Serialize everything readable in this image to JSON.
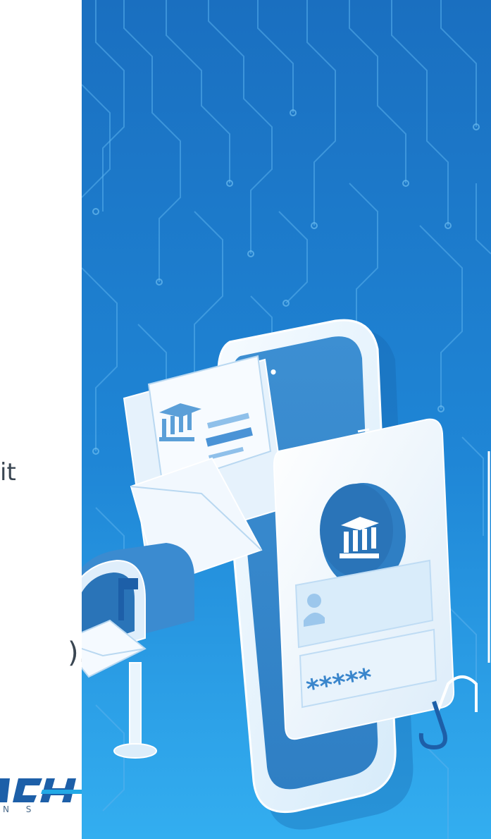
{
  "left_text": {
    "fragment_line1": "it",
    "fragment_line2": ")."
  },
  "logo": {
    "mark_text": "CH",
    "subtitle": "N S"
  },
  "illustration": {
    "password_text": "*****",
    "phone_menu_dots": "•••",
    "colors": {
      "bg_top": "#1f78c8",
      "bg_bottom": "#2aa2ec",
      "circuit": "#4aa6e6",
      "phone_frame": "#eaf5fd",
      "screen": "#3a8fd4",
      "card": "#f4f9fe",
      "accent_dark": "#2e6fae",
      "logo_blue": "#1d5fa8",
      "logo_cyan": "#22a9e6"
    }
  }
}
